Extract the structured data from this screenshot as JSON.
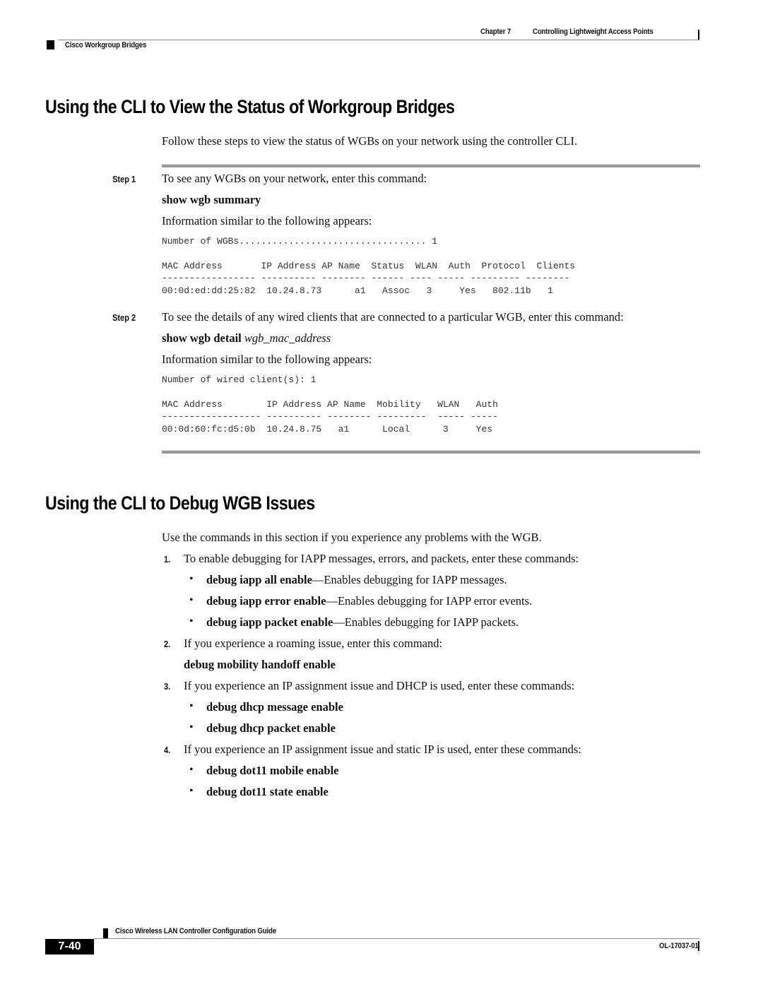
{
  "header": {
    "chapter": "Chapter 7",
    "chapter_title": "Controlling Lightweight Access Points",
    "section": "Cisco Workgroup Bridges"
  },
  "section1": {
    "title": "Using the CLI to View the Status of Workgroup Bridges",
    "intro": "Follow these steps to view the status of WGBs on your network using the controller CLI.",
    "step1": {
      "label": "Step 1",
      "text": "To see any WGBs on your network, enter this command:",
      "command": "show wgb summary",
      "info": "Information similar to the following appears:",
      "output": {
        "count_line": "Number of WGBs.................................. 1",
        "header_line": "MAC Address       IP Address AP Name  Status  WLAN  Auth  Protocol  Clients",
        "dash_line": "----------------- ---------- -------- ------ ---- ----- --------- --------",
        "row_line": "00:0d:ed:dd:25:82  10.24.8.73      a1   Assoc   3     Yes   802.11b   1"
      }
    },
    "step2": {
      "label": "Step 2",
      "text": "To see the details of any wired clients that are connected to a particular WGB, enter this command:",
      "command": "show wgb detail",
      "command_arg": "wgb_mac_address",
      "info": "Information similar to the following appears:",
      "output": {
        "count_line": "Number of wired client(s): 1",
        "header_line": "MAC Address        IP Address AP Name  Mobility   WLAN   Auth",
        "dash_line": "------------------ ---------- -------- ---------  ----- -----",
        "row_line": "00:0d:60:fc:d5:0b  10.24.8.75   a1      Local      3     Yes"
      }
    }
  },
  "section2": {
    "title": "Using the CLI to Debug WGB Issues",
    "intro": "Use the commands in this section if you experience any problems with the WGB.",
    "items": [
      {
        "num": "1.",
        "text": "To enable debugging for IAPP messages, errors, and packets, enter these commands:",
        "bullets": [
          {
            "cmd": "debug iapp all enable",
            "desc": "—Enables debugging for IAPP messages."
          },
          {
            "cmd": "debug iapp error enable",
            "desc": "—Enables debugging for IAPP error events."
          },
          {
            "cmd": "debug iapp packet enable",
            "desc": "—Enables debugging for IAPP packets."
          }
        ]
      },
      {
        "num": "2.",
        "text": "If you experience a roaming issue, enter this command:",
        "command": "debug mobility handoff enable"
      },
      {
        "num": "3.",
        "text": "If you experience an IP assignment issue and DHCP is used, enter these commands:",
        "bullets": [
          {
            "cmd": "debug dhcp message enable"
          },
          {
            "cmd": "debug dhcp packet enable"
          }
        ]
      },
      {
        "num": "4.",
        "text": "If you experience an IP assignment issue and static IP is used, enter these commands:",
        "bullets": [
          {
            "cmd": "debug dot11 mobile enable"
          },
          {
            "cmd": "debug dot11 state enable"
          }
        ]
      }
    ]
  },
  "footer": {
    "guide_title": "Cisco Wireless LAN Controller Configuration Guide",
    "page_number": "7-40",
    "doc_id": "OL-17037-01"
  },
  "icons": {
    "bullet": "•"
  }
}
